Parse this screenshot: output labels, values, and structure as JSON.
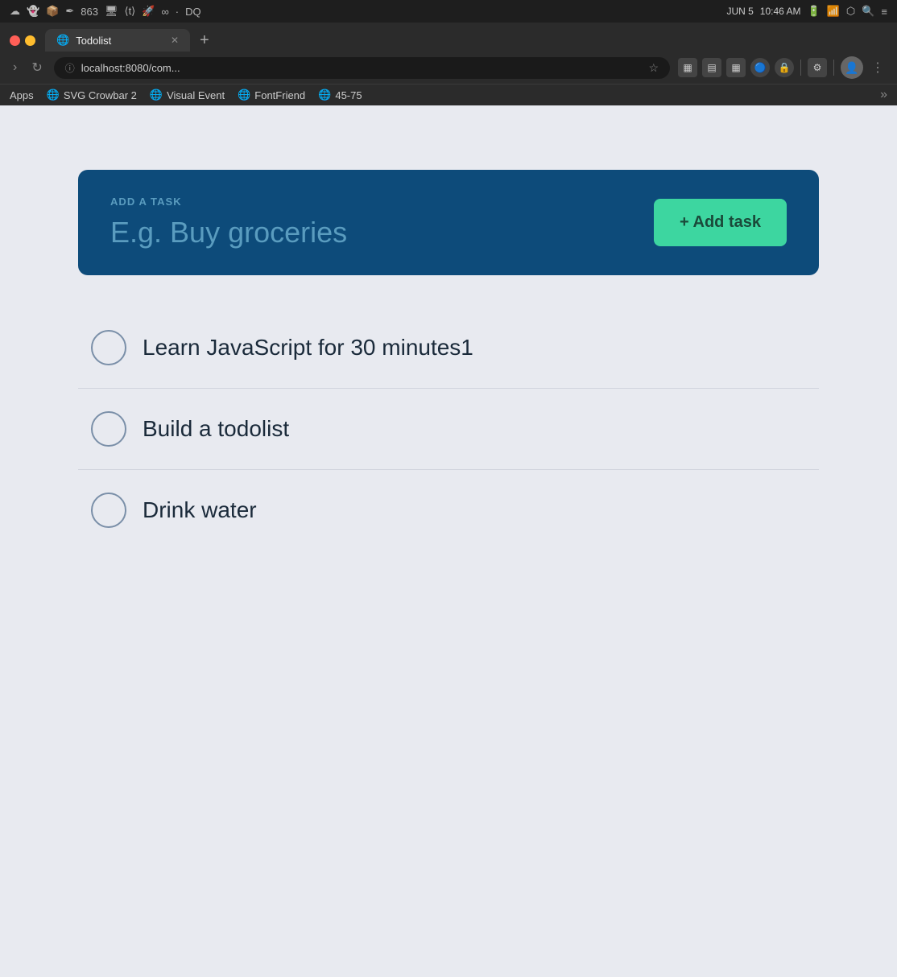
{
  "system_bar": {
    "time": "10:46 AM",
    "date": "JUN 5",
    "icons_left": [
      "cloud-icon",
      "snapchat-icon",
      "dropbox-icon",
      "pen-icon",
      "badge-863",
      "monitor-icon",
      "transit-icon",
      "rocket-icon",
      "infinity-icon",
      "dot",
      "dq-icon"
    ],
    "icons_right": [
      "search-icon",
      "menu-icon",
      "bluetooth-icon",
      "wifi-icon",
      "battery-icon"
    ]
  },
  "browser": {
    "tab": {
      "title": "Todolist",
      "url": "localhost:8080/com..."
    },
    "bookmarks": [
      {
        "label": "Apps"
      },
      {
        "label": "SVG Crowbar 2"
      },
      {
        "label": "Visual Event"
      },
      {
        "label": "FontFriend"
      },
      {
        "label": "45-75"
      }
    ]
  },
  "add_task_section": {
    "label": "Add a task",
    "placeholder": "E.g. Buy groceries",
    "button_label": "+ Add task"
  },
  "tasks": [
    {
      "id": 1,
      "text": "Learn JavaScript for 30 minutes1",
      "done": false
    },
    {
      "id": 2,
      "text": "Build a todolist",
      "done": false
    },
    {
      "id": 3,
      "text": "Drink water",
      "done": false
    }
  ],
  "colors": {
    "card_bg": "#0d4b7a",
    "btn_bg": "#3dd6a0",
    "page_bg": "#e8eaf0",
    "task_text": "#1a2a3a",
    "placeholder_color": "#5a9cbf"
  }
}
